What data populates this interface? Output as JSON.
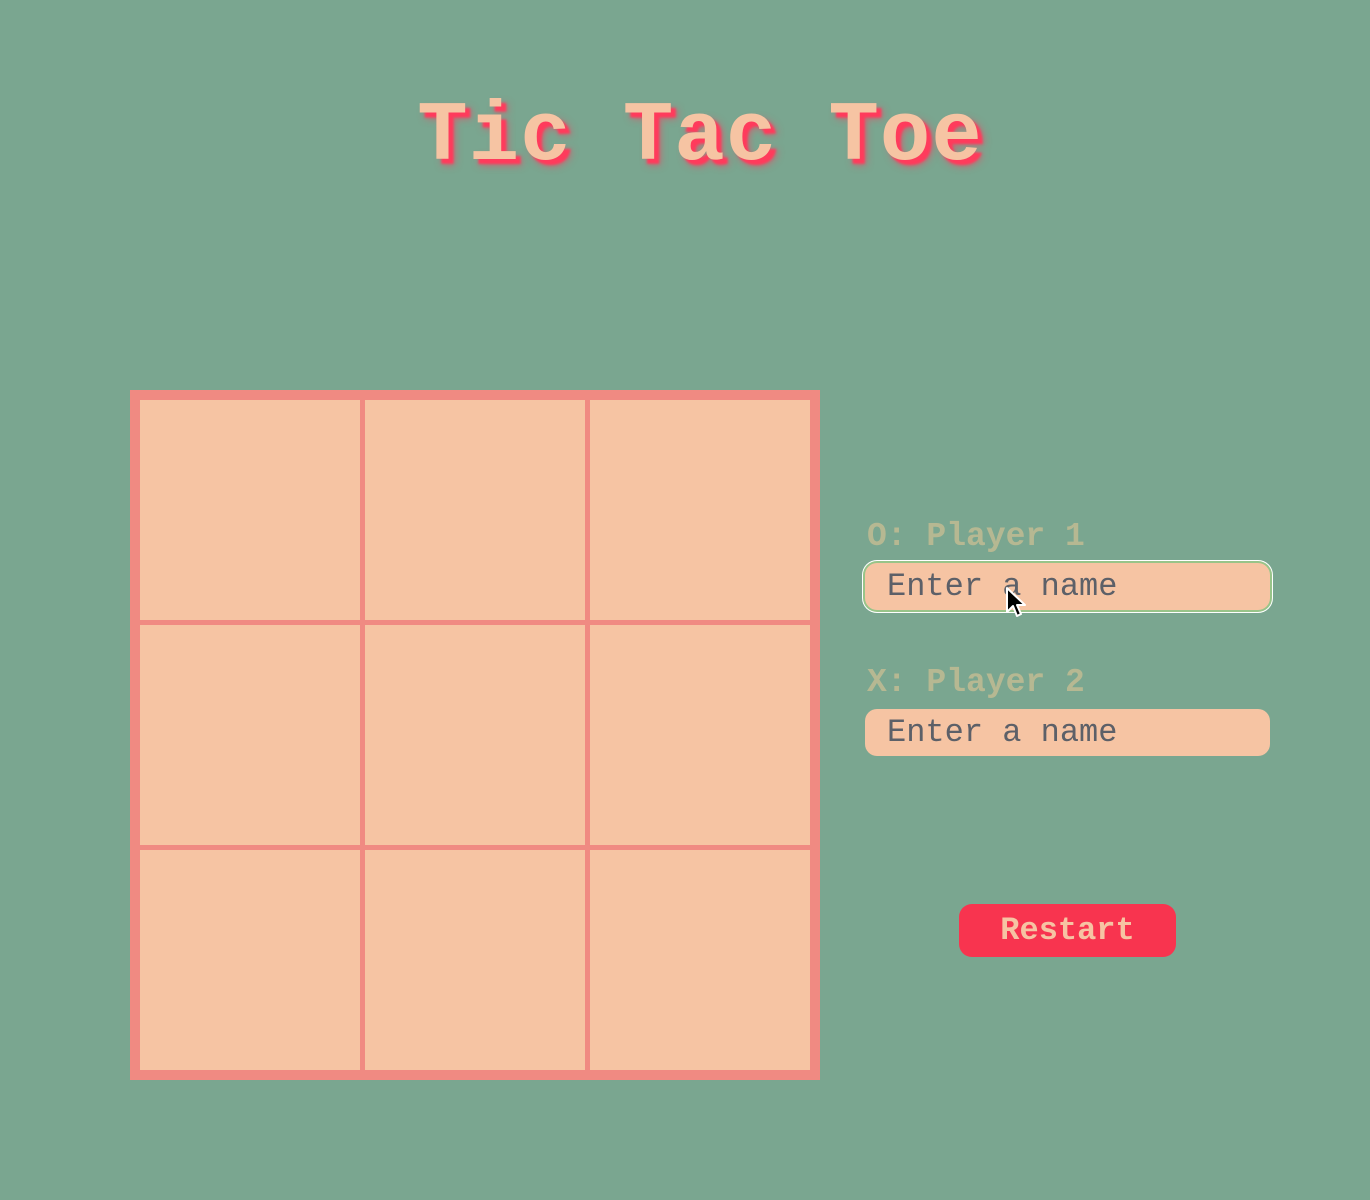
{
  "title": "Tic Tac Toe",
  "board": {
    "cells": [
      "",
      "",
      "",
      "",
      "",
      "",
      "",
      "",
      ""
    ]
  },
  "players": [
    {
      "label": "O: Player 1",
      "placeholder": "Enter a name",
      "value": ""
    },
    {
      "label": "X: Player 2",
      "placeholder": "Enter a name",
      "value": ""
    }
  ],
  "restart_label": "Restart",
  "colors": {
    "background": "#7aa690",
    "board_frame": "#f08a82",
    "cell": "#f6c4a3",
    "title_shadow": "#ff3b5c",
    "button": "#f8344f",
    "player_label": "#b6b892"
  }
}
